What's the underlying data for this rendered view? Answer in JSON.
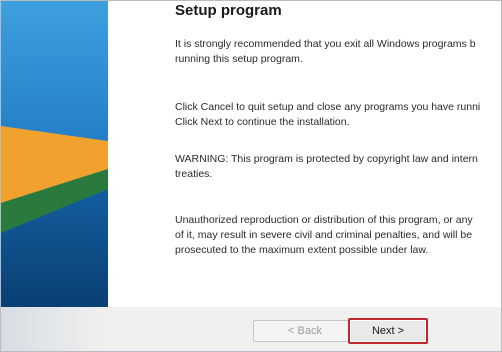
{
  "window": {
    "title": "Setup program"
  },
  "main": {
    "paragraphs": [
      "It is strongly recommended that you exit all Windows programs b\nrunning this setup program.",
      "Click Cancel to quit setup and close any programs you have runni\nClick Next to continue the installation.",
      "WARNING: This program is protected by copyright law and intern\ntreaties.",
      "Unauthorized reproduction or distribution of this program, or any\nof it, may result in severe civil and criminal penalties, and will be\nprosecuted to the maximum extent possible under law."
    ]
  },
  "buttons": {
    "back": "< Back",
    "next": "Next >"
  },
  "colors": {
    "panel_blue": "#0f5a9a",
    "panel_orange": "#f0a12e",
    "panel_green": "#2a7a3e",
    "highlight": "#c0282d"
  }
}
